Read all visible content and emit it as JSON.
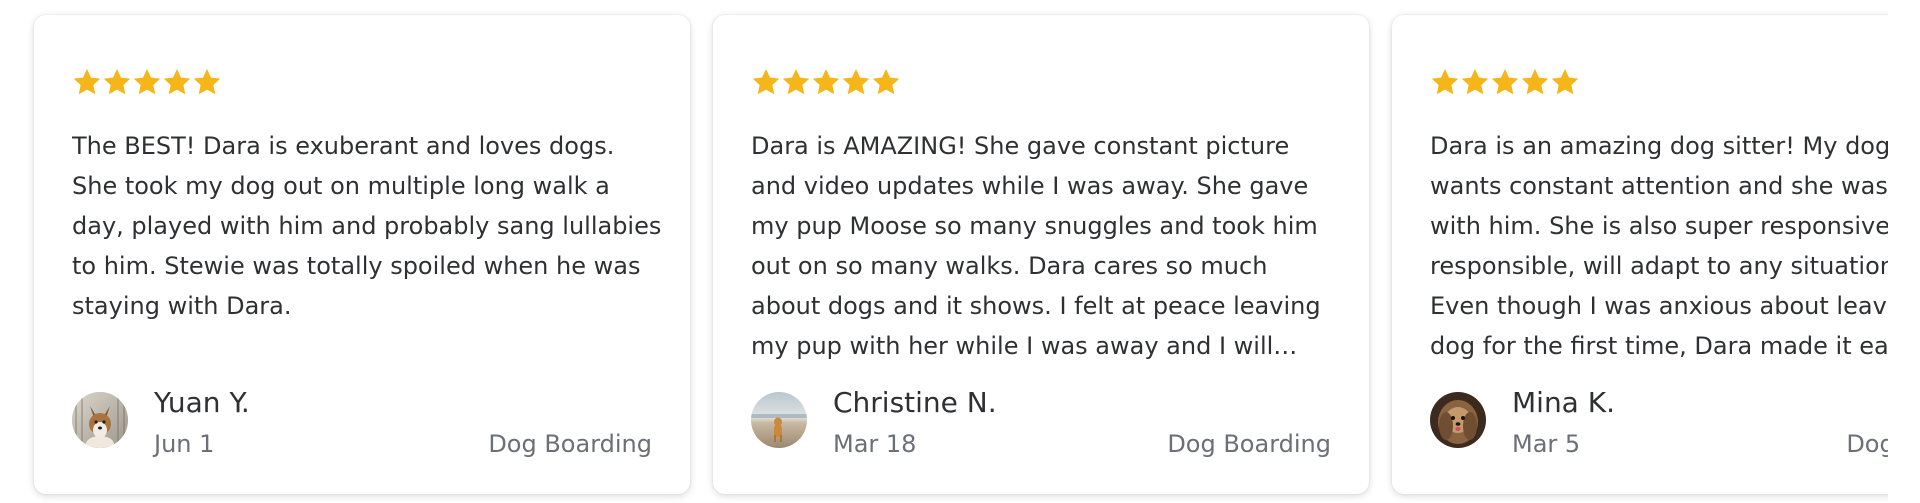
{
  "colors": {
    "star": "#f6b518",
    "text": "#2f3033",
    "muted": "#6c6f77"
  },
  "reviews": [
    {
      "rating": 5,
      "text": "The BEST! Dara is exuberant and loves dogs. She took my dog out on multiple long walk a day, played with him and probably sang lullabies to him. Stewie was totally spoiled when he was staying with Dara.",
      "name": "Yuan Y.",
      "date": "Jun 1",
      "service": "Dog Boarding",
      "avatar_icon": "corgi-dog-photo-icon"
    },
    {
      "rating": 5,
      "text": "Dara is AMAZING! She gave constant picture and video updates while I was away. She gave my pup Moose so many snuggles and took him out on so many walks. Dara cares so much about dogs and it shows. I felt at peace leaving my pup with her while I was away and I will definitely use Dara again!",
      "name": "Christine N.",
      "date": "Mar 18",
      "service": "Dog Boarding",
      "avatar_icon": "dog-on-beach-photo-icon"
    },
    {
      "rating": 5,
      "text": "Dara is an amazing dog sitter! My dog likes and wants constant attention and she was so patient with him. She is also super responsive and responsible, will adapt to any situation possible. Even though I was anxious about leaving my dog for the first time, Dara made it easy.",
      "name": "Mina K.",
      "date": "Mar 5",
      "service": "Dog Boarding",
      "avatar_icon": "yorkie-dog-photo-icon"
    }
  ]
}
